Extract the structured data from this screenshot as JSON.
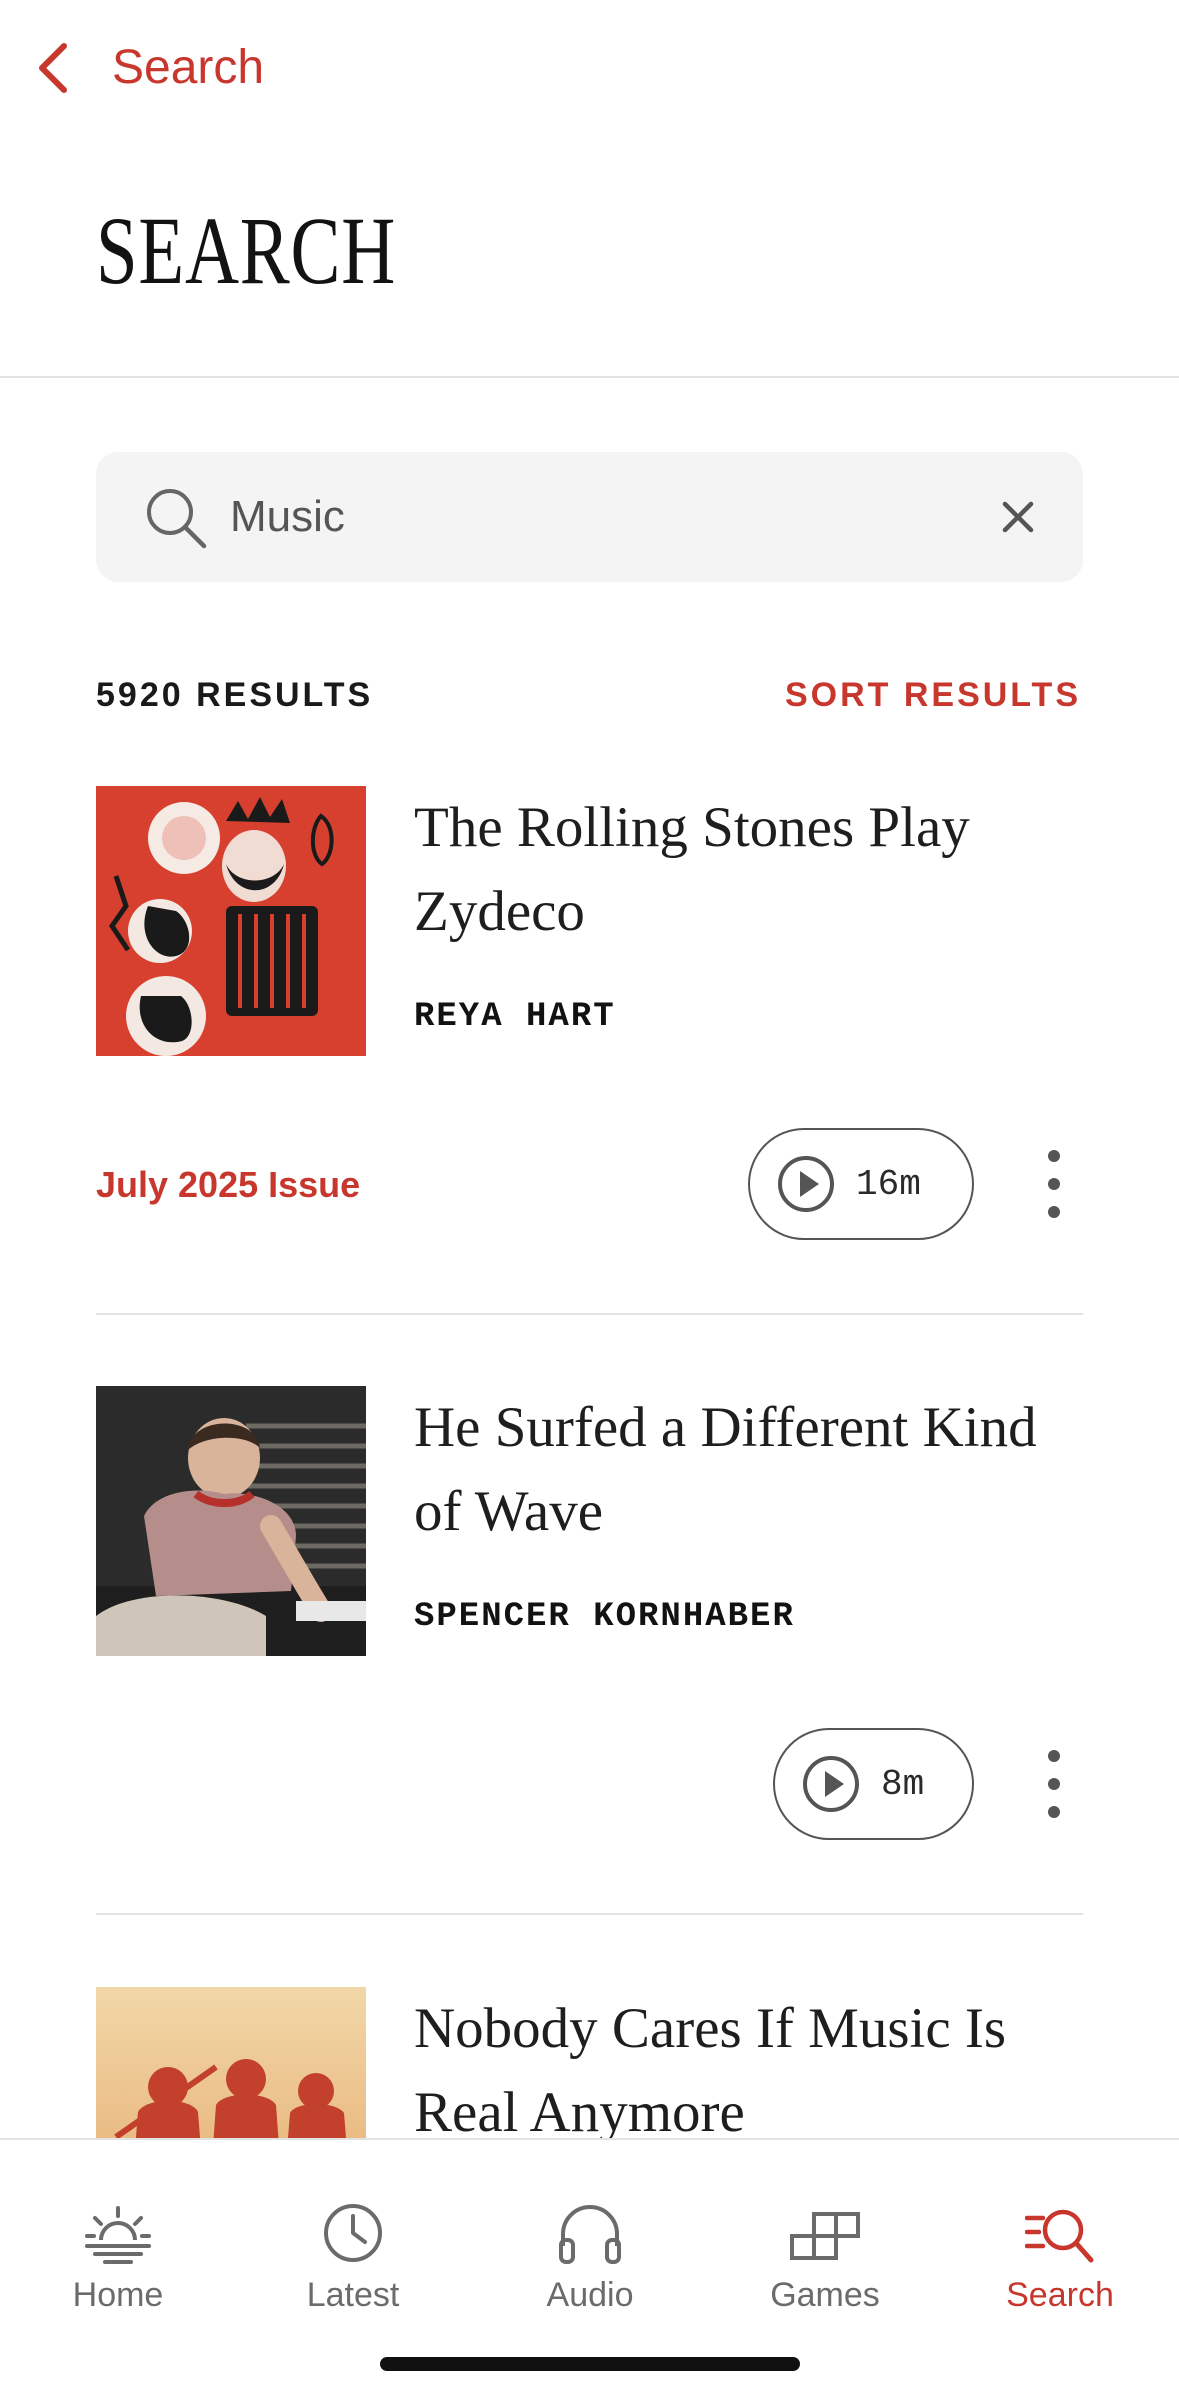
{
  "nav": {
    "back_label": "Search"
  },
  "page_title": "SEARCH",
  "search": {
    "value": "Music",
    "placeholder": "Search"
  },
  "results_header": {
    "count_label": "5920 RESULTS",
    "sort_label": "SORT RESULTS"
  },
  "results": [
    {
      "title": "The Rolling Stones Play Zydeco",
      "author": "REYA HART",
      "issue": "July 2025 Issue",
      "duration": "16m",
      "thumb_icon": "illustration-accordion-player"
    },
    {
      "title": "He Surfed a Different Kind of Wave",
      "author": "SPENCER KORNHABER",
      "issue": "",
      "duration": "8m",
      "thumb_icon": "photo-musician-at-keyboard"
    },
    {
      "title": "Nobody Cares If Music Is Real Anymore",
      "author": "",
      "issue": "",
      "duration": "",
      "thumb_icon": "photo-band-silhouettes"
    }
  ],
  "tabbar": {
    "tabs": [
      {
        "label": "Home",
        "icon": "sunrise-icon"
      },
      {
        "label": "Latest",
        "icon": "clock-icon"
      },
      {
        "label": "Audio",
        "icon": "headphones-icon"
      },
      {
        "label": "Games",
        "icon": "games-icon"
      },
      {
        "label": "Search",
        "icon": "search-list-icon"
      }
    ],
    "active": "Search"
  },
  "colors": {
    "accent": "#c8372d",
    "text": "#1a1a1a",
    "muted": "#6b6b6b",
    "search_bg": "#f4f4f4"
  }
}
